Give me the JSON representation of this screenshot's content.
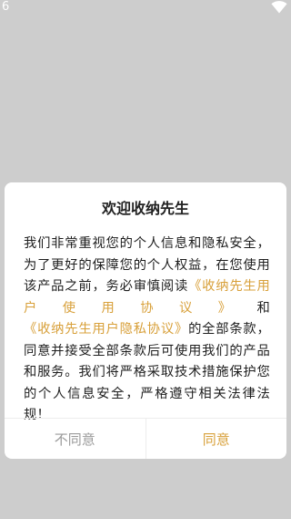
{
  "status_bar": {
    "time": "6",
    "wifi_icon": "wifi-icon"
  },
  "dialog": {
    "title": "欢迎收纳先生",
    "body": {
      "part1": "我们非常重视您的个人信息和隐私安全，为了更好的保障您的个人权益，在您使用该产品之前，务必审慎阅读",
      "link1": "《收纳先生用户使用协议》",
      "part2": "和",
      "link2": "《收纳先生用户隐私协议》",
      "part3": "的全部条款，同意并接受全部条款后可使用我们的产品和服务。我们将严格采取技术措施保护您的个人信息安全，严格遵守相关法律法规！"
    },
    "buttons": {
      "disagree": "不同意",
      "agree": "同意"
    }
  },
  "colors": {
    "backdrop": "#cdcdcd",
    "accent": "#d8a03a",
    "disagree_text": "#9a9a9a"
  }
}
